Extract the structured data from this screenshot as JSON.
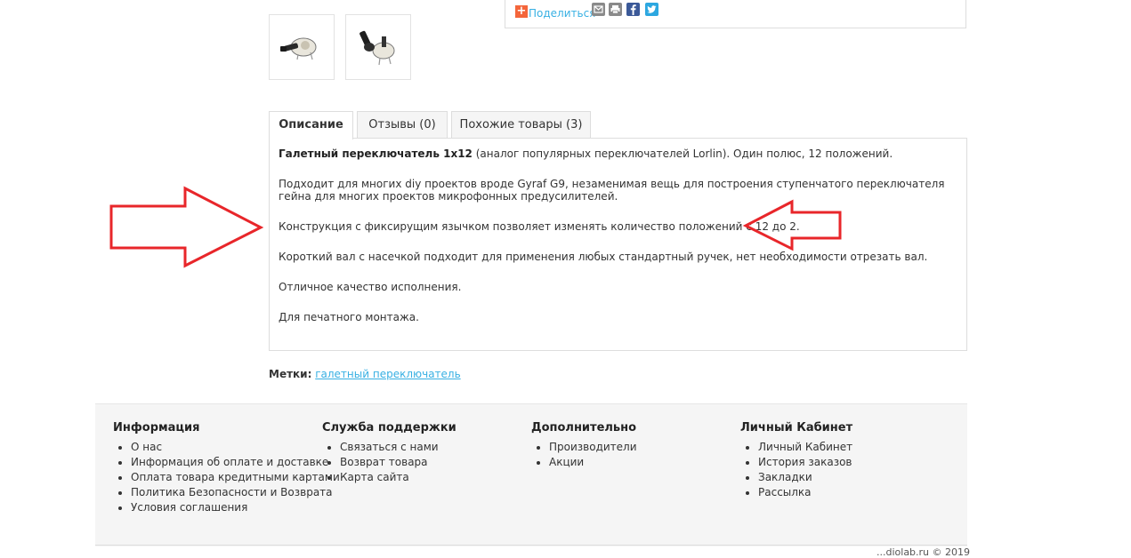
{
  "share": {
    "label": "Поделиться",
    "plus_glyph": "+",
    "icons": [
      "email-icon",
      "print-icon",
      "facebook-icon",
      "twitter-icon"
    ]
  },
  "tabs": [
    {
      "label": "Описание",
      "active": true
    },
    {
      "label": "Отзывы (0)",
      "active": false
    },
    {
      "label": "Похожие товары (3)",
      "active": false
    }
  ],
  "description": {
    "intro_bold": "Галетный переключатель 1x12",
    "intro_rest": " (аналог популярных переключателей Lorlin). Один полюс, 12 положений.",
    "p2": "Подходит для многих diy проектов вроде Gyraf G9, незаменимая вещь для построения ступенчатого переключателя гейна для многих проектов микрофонных предусилителей.",
    "p3": "Конструкция с фиксирущим язычком позволяет изменять количество положений с 12 до 2.",
    "p4": "Короткий вал с насечкой подходит для применения любых стандартный ручек, нет необходимости отрезать вал.",
    "p5": "Отличное качество исполнения.",
    "p6": "Для печатного монтажа."
  },
  "tags": {
    "label": "Метки:",
    "link": "галетный переключатель"
  },
  "footer": {
    "columns": [
      {
        "title": "Информация",
        "items": [
          "О нас",
          "Информация об оплате и доставке",
          "Оплата товара кредитными картами",
          "Политика Безопасности и Возврата",
          "Условия соглашения"
        ]
      },
      {
        "title": "Служба поддержки",
        "items": [
          "Связаться с нами",
          "Возврат товара",
          "Карта сайта"
        ]
      },
      {
        "title": "Дополнительно",
        "items": [
          "Производители",
          "Акции"
        ]
      },
      {
        "title": "Личный Кабинет",
        "items": [
          "Личный Кабинет",
          "История заказов",
          "Закладки",
          "Рассылка"
        ]
      }
    ],
    "copyright": "...diolab.ru © 2019"
  },
  "colors": {
    "link": "#38b0e3",
    "annotation_arrow": "#e8262a",
    "share_plus": "#f4663b",
    "facebook": "#3b5998",
    "twitter": "#2ca7e0"
  }
}
